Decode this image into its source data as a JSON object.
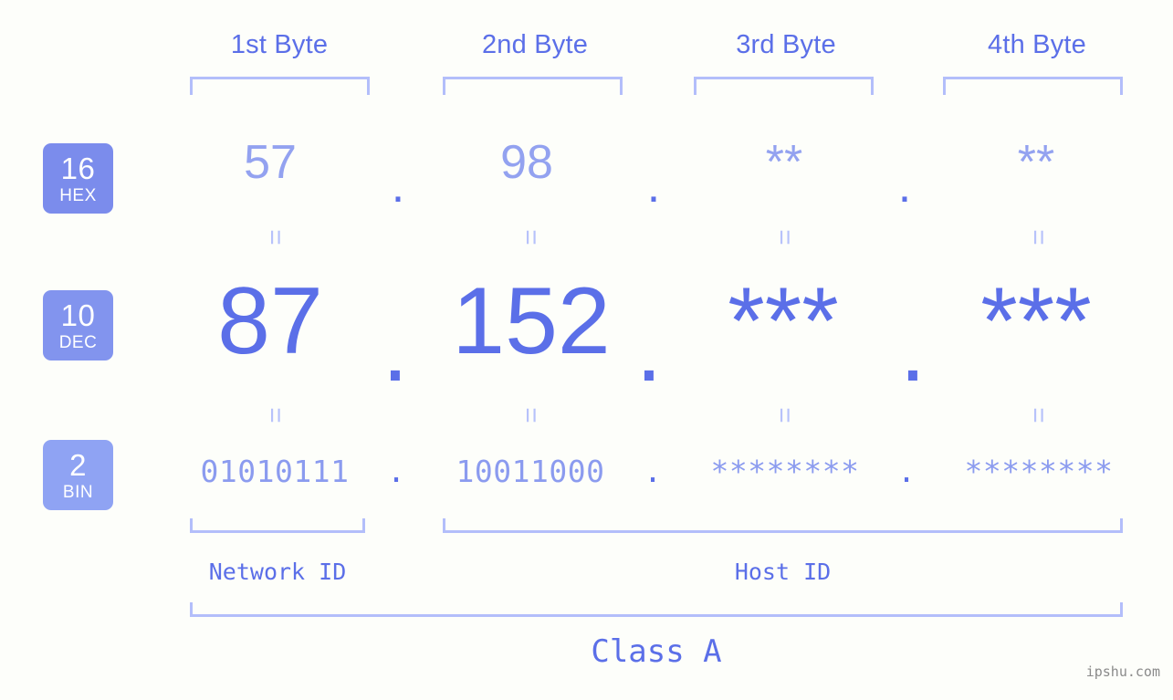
{
  "watermark": "ipshu.com",
  "byte_headers": [
    {
      "label": "1st Byte"
    },
    {
      "label": "2nd Byte"
    },
    {
      "label": "3rd Byte"
    },
    {
      "label": "4th Byte"
    }
  ],
  "rows": [
    {
      "base_number": "16",
      "base_name": "HEX",
      "values": [
        "57",
        "98",
        "**",
        "**"
      ],
      "separators": [
        ".",
        ".",
        "."
      ]
    },
    {
      "base_number": "10",
      "base_name": "DEC",
      "values": [
        "87",
        "152",
        "***",
        "***"
      ],
      "separators": [
        ".",
        ".",
        "."
      ]
    },
    {
      "base_number": "2",
      "base_name": "BIN",
      "values": [
        "01010111",
        "10011000",
        "********",
        "********"
      ],
      "separators": [
        ".",
        ".",
        "."
      ]
    }
  ],
  "equals_marks": {
    "glyph": "="
  },
  "footer": {
    "network_id_label": "Network ID",
    "host_id_label": "Host ID",
    "class_label": "Class A"
  },
  "colors": {
    "background": "#fdfefa",
    "accent_strong": "#5b6fe8",
    "accent_mid": "#8b9bef",
    "accent_light": "#b3befa",
    "badge_hex": "#7b8cec",
    "badge_dec": "#8294ee",
    "badge_bin": "#8fa3f3"
  }
}
